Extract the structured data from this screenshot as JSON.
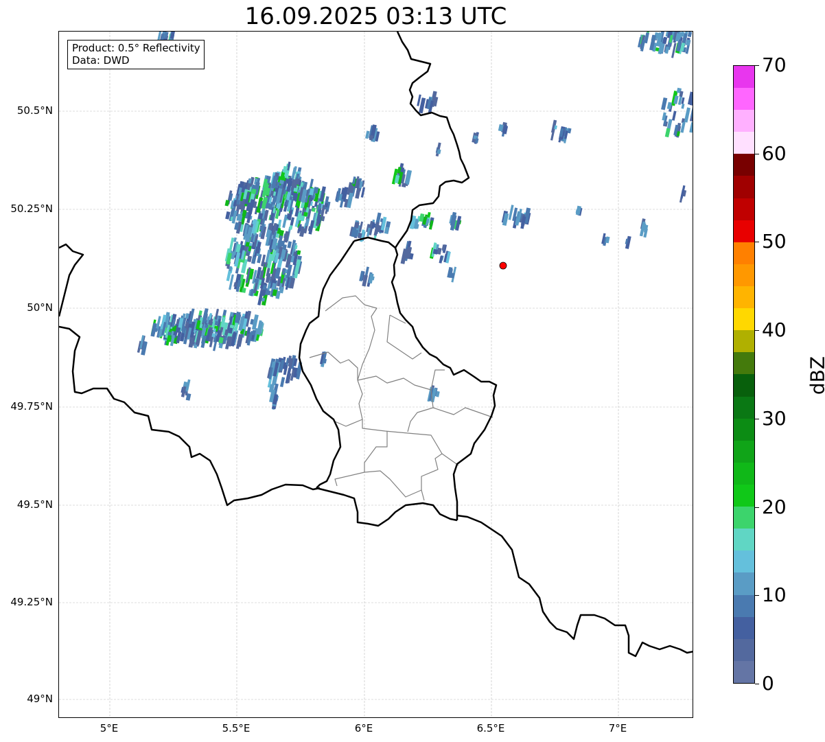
{
  "title": "16.09.2025 03:13 UTC",
  "annotation": {
    "line1": "Product: 0.5° Reflectivity",
    "line2": "Data: DWD"
  },
  "x_ticks": [
    "5°E",
    "5.5°E",
    "6°E",
    "6.5°E",
    "7°E"
  ],
  "y_ticks": [
    "50.5°N",
    "50.25°N",
    "50°N",
    "49.75°N",
    "49.5°N",
    "49.25°N",
    "49°N"
  ],
  "colorbar": {
    "label": "dBZ",
    "ticks": [
      "0",
      "10",
      "20",
      "30",
      "40",
      "50",
      "60",
      "70"
    ],
    "range": [
      0,
      70
    ],
    "step": 2.5,
    "colors": [
      "#6475a5",
      "#53699e",
      "#4460a0",
      "#4a7ab0",
      "#5a9cc5",
      "#64c0dc",
      "#60d6c4",
      "#3cd46c",
      "#10c818",
      "#10b818",
      "#10a418",
      "#0c8c14",
      "#0a7814",
      "#08600c",
      "#447a0c",
      "#b0b000",
      "#ffd800",
      "#ffb400",
      "#ff9800",
      "#ff8000",
      "#e80000",
      "#c00000",
      "#a00000",
      "#780000",
      "#ffe0ff",
      "#ffb0ff",
      "#ff66ff",
      "#e836ee"
    ]
  },
  "marker": {
    "color": "#ff0000"
  },
  "borders": {
    "country_color": "#000000",
    "canton_color": "#808080",
    "grid_color": "#bbbbbb"
  }
}
